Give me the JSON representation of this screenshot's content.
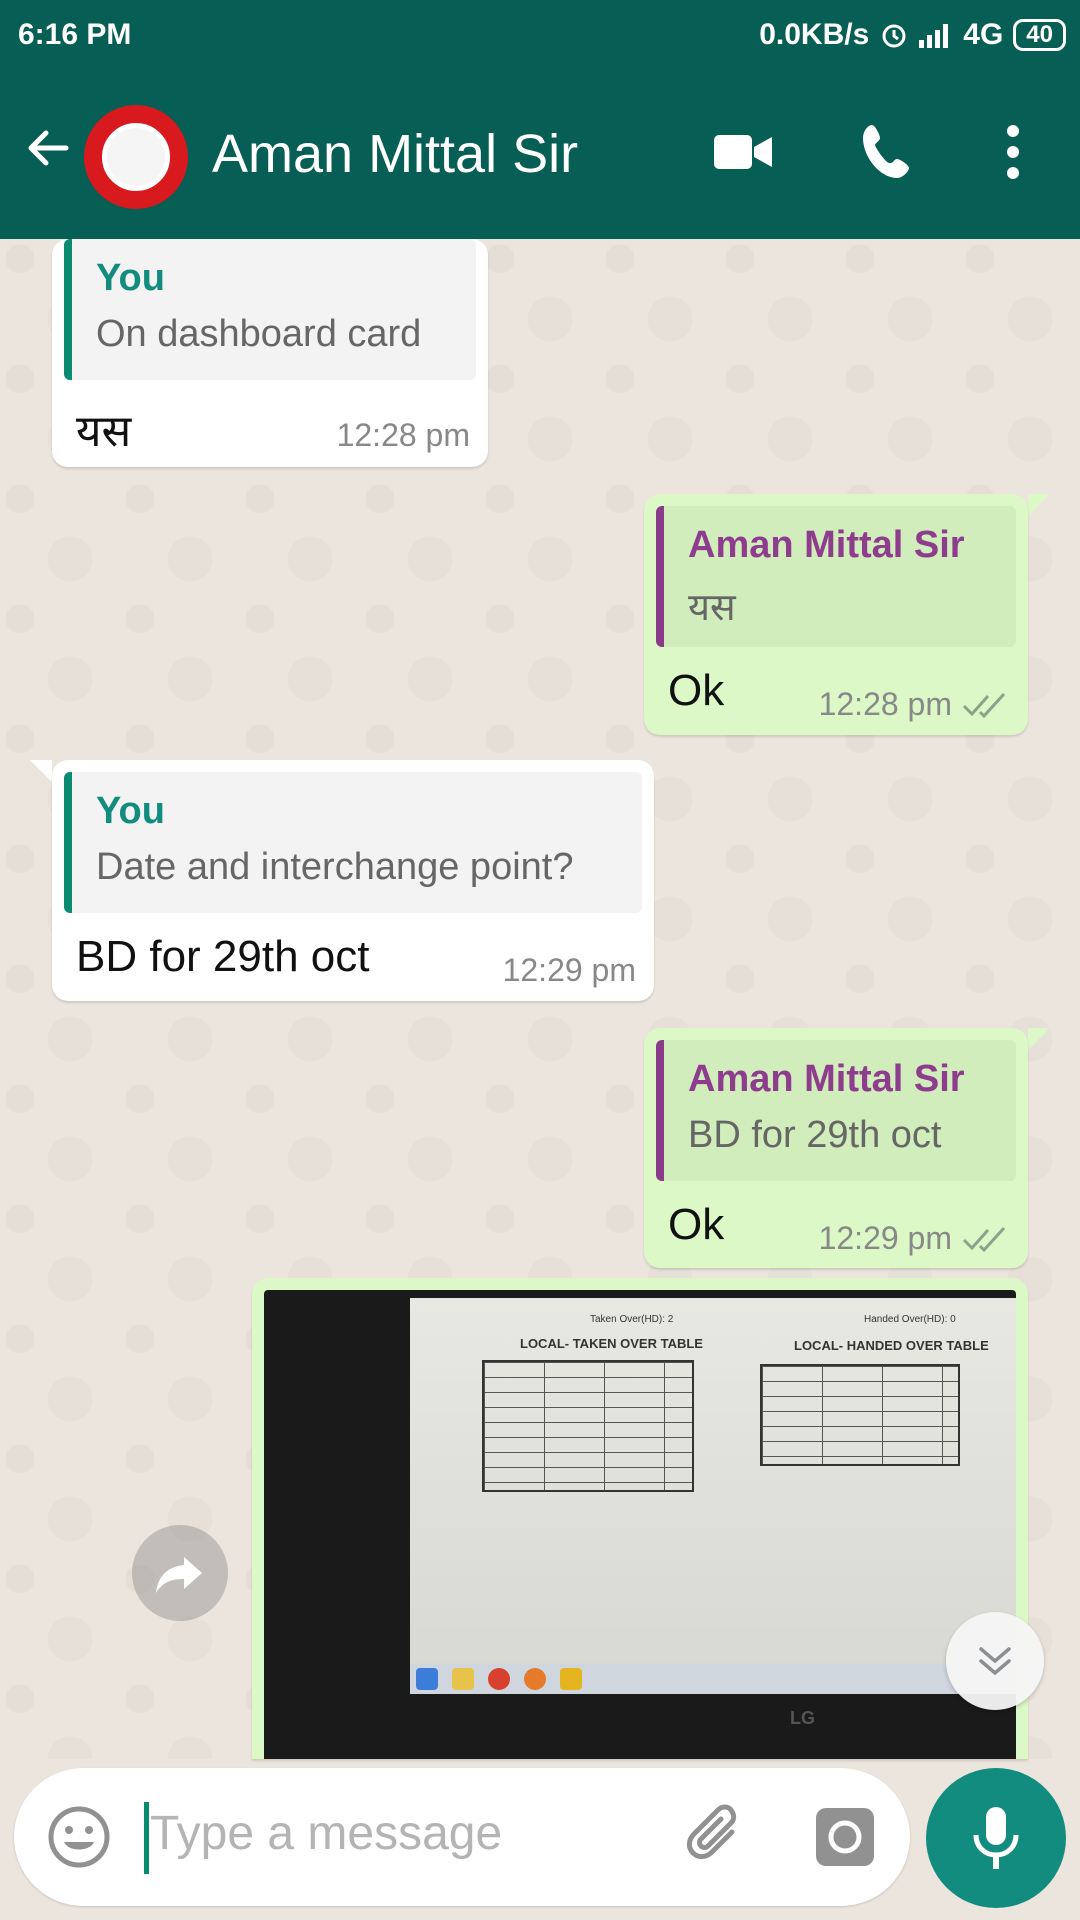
{
  "status_bar": {
    "time": "6:16 PM",
    "speed": "0.0KB/s",
    "network": "4G",
    "battery": "40"
  },
  "header": {
    "contact_name": "Aman Mittal Sir"
  },
  "messages": [
    {
      "direction": "incoming",
      "quote_name": "You",
      "quote_text": "On dashboard card",
      "text": "यस",
      "time": "12:28 pm"
    },
    {
      "direction": "outgoing",
      "quote_name": "Aman Mittal Sir",
      "quote_text": "यस",
      "text": "Ok",
      "time": "12:28 pm"
    },
    {
      "direction": "incoming",
      "quote_name": "You",
      "quote_text": "Date and interchange point?",
      "text": "BD for 29th oct",
      "time": "12:29 pm"
    },
    {
      "direction": "outgoing",
      "quote_name": "Aman Mittal Sir",
      "quote_text": "BD for 29th oct",
      "text": "Ok",
      "time": "12:29 pm"
    }
  ],
  "photo_message": {
    "left_table_title": "LOCAL- TAKEN OVER TABLE",
    "right_table_title": "LOCAL- HANDED OVER TABLE",
    "top_left_note": "Taken Over(HD): 2",
    "top_right_note": "Handed Over(HD): 0",
    "brand": "LG"
  },
  "composer": {
    "placeholder": "Type a message"
  },
  "colors": {
    "header_bg": "#075e54",
    "outgoing_bubble": "#dcf8c6",
    "incoming_bubble": "#ffffff",
    "accent": "#128c7e"
  }
}
